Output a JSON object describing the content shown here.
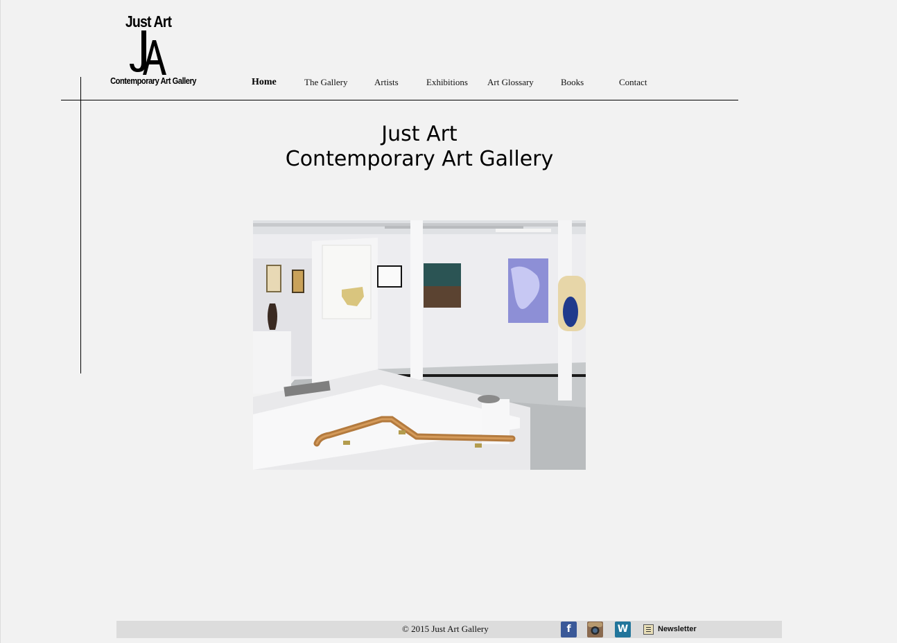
{
  "logo": {
    "top_text": "Just Art",
    "mark": "JA",
    "bottom_text": "Contemporary Art Gallery"
  },
  "nav": {
    "items": [
      {
        "label": "Home",
        "active": true
      },
      {
        "label": "The Gallery"
      },
      {
        "label": "Artists"
      },
      {
        "label": "Exhibitions"
      },
      {
        "label": "Art Glossary"
      },
      {
        "label": "Books"
      },
      {
        "label": "Contact"
      }
    ]
  },
  "main": {
    "headline_line1": "Just Art",
    "headline_line2": "Contemporary Art Gallery"
  },
  "footer": {
    "copyright": "© 2015 Just Art Gallery",
    "social": [
      {
        "icon": "facebook-icon",
        "glyph": "f",
        "color": "#3b5998"
      },
      {
        "icon": "instagram-icon",
        "color": "#8a6a4f"
      },
      {
        "icon": "wordpress-icon",
        "glyph": "W",
        "color": "#21759b"
      }
    ],
    "newsletter_label": "Newsletter"
  }
}
